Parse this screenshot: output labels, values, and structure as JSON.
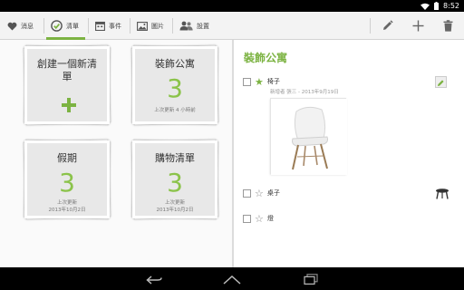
{
  "status_bar": {
    "time": "8:52"
  },
  "tabs": [
    {
      "label": "消息",
      "icon": "heart-icon"
    },
    {
      "label": "清單",
      "icon": "checkmark-icon",
      "active": true
    },
    {
      "label": "事件",
      "icon": "calendar-icon"
    },
    {
      "label": "圖片",
      "icon": "image-icon"
    },
    {
      "label": "設置",
      "icon": "people-icon"
    }
  ],
  "actions": [
    {
      "name": "edit",
      "icon": "pencil-icon"
    },
    {
      "name": "add",
      "icon": "plus-icon"
    },
    {
      "name": "delete",
      "icon": "trash-icon"
    }
  ],
  "cards": [
    {
      "title": "創建一個新清單",
      "action": "create"
    },
    {
      "title": "裝飾公寓",
      "count": "3",
      "meta_line1": "上次更新 4 小時前",
      "meta_line2": ""
    },
    {
      "title": "假期",
      "count": "3",
      "meta_line1": "上次更新",
      "meta_line2": "2013年10月2日"
    },
    {
      "title": "購物清單",
      "count": "3",
      "meta_line1": "上次更新",
      "meta_line2": "2013年10月2日"
    }
  ],
  "detail": {
    "title": "裝飾公寓",
    "items": [
      {
        "name": "椅子",
        "starred": true,
        "meta": "新增者 張三 - 2013年9月19日",
        "image": "white-chair",
        "icon": "pencil-icon"
      },
      {
        "name": "桌子",
        "starred": false,
        "icon": "stool-icon"
      },
      {
        "name": "燈",
        "starred": false
      }
    ]
  },
  "colors": {
    "accent": "#7cb342",
    "count": "#8bc34a",
    "actionbar": "#f3f3f3"
  }
}
